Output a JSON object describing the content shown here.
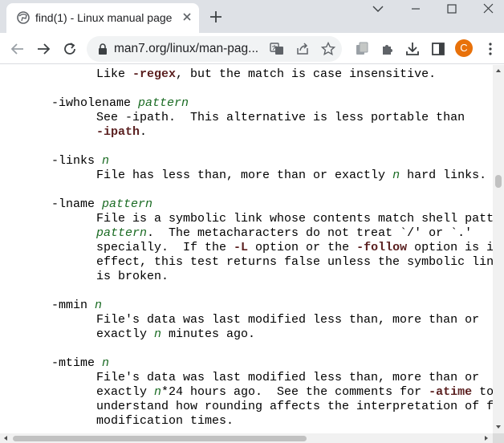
{
  "tab": {
    "title": "find(1) - Linux manual page"
  },
  "address": {
    "url": "man7.org/linux/man-pag..."
  },
  "profile": {
    "initial": "C",
    "color": "#e8710a"
  },
  "man": {
    "l01": {
      "a": "Like ",
      "b": "-regex",
      "c": ", but the match is case insensitive."
    },
    "l02": {
      "a": "-iwholename ",
      "b": "pattern"
    },
    "l03": {
      "a": "See -ipath.  This alternative is less portable than"
    },
    "l04": {
      "a": "-ipath",
      "b": "."
    },
    "l05": {
      "a": "-links ",
      "b": "n"
    },
    "l06": {
      "a": "File has less than, more than or exactly ",
      "b": "n",
      "c": " hard links."
    },
    "l07": {
      "a": "-lname ",
      "b": "pattern"
    },
    "l08": {
      "a": "File is a symbolic link whose contents match shell pattern"
    },
    "l09": {
      "a": "pattern",
      "b": ".  The metacharacters do not treat `/' or `.'"
    },
    "l10": {
      "a": "specially.  If the ",
      "b": "-L",
      "c": " option or the ",
      "d": "-follow",
      "e": " option is in"
    },
    "l11": {
      "a": "effect, this test returns false unless the symbolic link"
    },
    "l12": {
      "a": "is broken."
    },
    "l13": {
      "a": "-mmin ",
      "b": "n"
    },
    "l14": {
      "a": "File's data was last modified less than, more than or"
    },
    "l15": {
      "a": "exactly ",
      "b": "n",
      "c": " minutes ago."
    },
    "l16": {
      "a": "-mtime ",
      "b": "n"
    },
    "l17": {
      "a": "File's data was last modified less than, more than or"
    },
    "l18": {
      "a": "exactly ",
      "b": "n",
      "c": "*24 hours ago.  See the comments for ",
      "d": "-atime",
      "e": " to"
    },
    "l19": {
      "a": "understand how rounding affects the interpretation of file"
    },
    "l20": {
      "a": "modification times."
    }
  }
}
